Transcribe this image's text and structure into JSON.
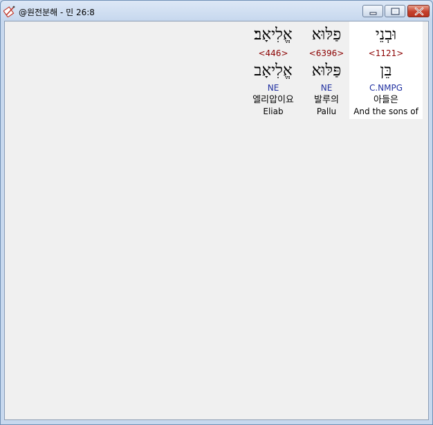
{
  "window": {
    "title": "@원전분해 - 민 26:8"
  },
  "words": [
    {
      "hebrew": "וּבְנֵי",
      "strong": "<1121>",
      "lemma": "בֵּן",
      "morph": "C.NMPG",
      "korean": "아들은",
      "english": "And the sons of",
      "selected": true
    },
    {
      "hebrew": "פַלּוּא",
      "strong": "<6396>",
      "lemma": "פַּלּוּא",
      "morph": "NE",
      "korean": "발루의",
      "english": "Pallu",
      "selected": false
    },
    {
      "hebrew": "אֱלִיאָב׃",
      "strong": "<446>",
      "lemma": "אֱלִיאָב",
      "morph": "NE",
      "korean": "엘리압이요",
      "english": "Eliab",
      "selected": false
    }
  ],
  "colors": {
    "strong": "#8b0000",
    "morph": "#1f2fa0",
    "selection": "#ffffff"
  },
  "icons": {
    "app": "pen-book-icon",
    "minimize": "minimize-icon",
    "maximize": "maximize-icon",
    "close": "close-icon"
  }
}
